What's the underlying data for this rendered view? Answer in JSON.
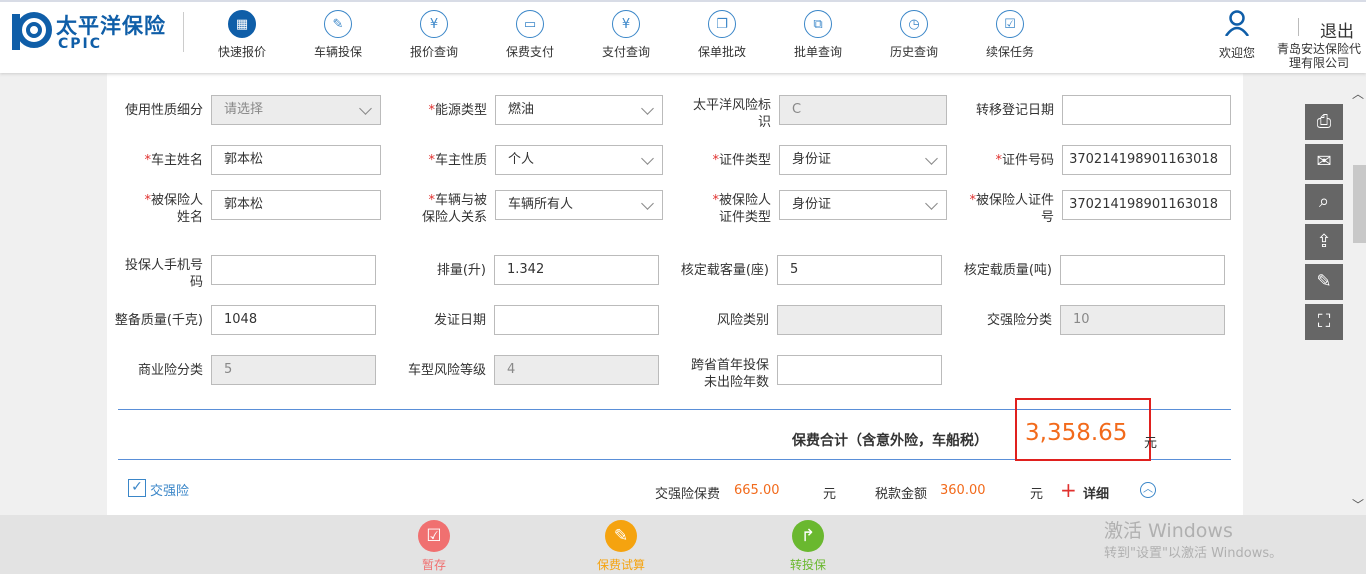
{
  "header": {
    "brand_cn": "太平洋保险",
    "brand_en": "CPIC",
    "nav": [
      {
        "label": "快速报价",
        "icon": "calculator-icon",
        "glyph": "▦"
      },
      {
        "label": "车辆投保",
        "icon": "policy-check-icon",
        "glyph": "✎"
      },
      {
        "label": "报价查询",
        "icon": "clipboard-yen-icon",
        "glyph": "¥"
      },
      {
        "label": "保费支付",
        "icon": "card-icon",
        "glyph": "▭"
      },
      {
        "label": "支付查询",
        "icon": "yen-search-icon",
        "glyph": "¥"
      },
      {
        "label": "保单批改",
        "icon": "copy-check-icon",
        "glyph": "❐"
      },
      {
        "label": "批单查询",
        "icon": "copy-search-icon",
        "glyph": "⧉"
      },
      {
        "label": "历史查询",
        "icon": "clock-icon",
        "glyph": "◷"
      },
      {
        "label": "续保任务",
        "icon": "task-check-icon",
        "glyph": "☑"
      }
    ],
    "welcome": "欢迎您",
    "company": "青岛安达保险代理有限公司",
    "logout": "退出"
  },
  "form": {
    "rows": [
      [
        {
          "label": "使用性质细分",
          "req": false,
          "value": "请选择",
          "type": "sel dis"
        },
        {
          "label": "能源类型",
          "req": true,
          "value": "燃油",
          "type": "sel"
        },
        {
          "label": "太平洋风险标\n识",
          "req": false,
          "value": "C",
          "type": "dis"
        },
        {
          "label": "转移登记日期",
          "req": false,
          "value": "",
          "type": ""
        }
      ],
      [
        {
          "label": "车主姓名",
          "req": true,
          "value": "郭本松",
          "type": ""
        },
        {
          "label": "车主性质",
          "req": true,
          "value": "个人",
          "type": "sel"
        },
        {
          "label": "证件类型",
          "req": true,
          "value": "身份证",
          "type": "sel"
        },
        {
          "label": "证件号码",
          "req": true,
          "value": "370214198901163018",
          "type": ""
        }
      ],
      [
        {
          "label": "被保险人\n姓名",
          "req": true,
          "value": "郭本松",
          "type": ""
        },
        {
          "label": "车辆与被\n保险人关系",
          "req": true,
          "value": "车辆所有人",
          "type": "sel"
        },
        {
          "label": "被保险人\n证件类型",
          "req": true,
          "value": "身份证",
          "type": "sel"
        },
        {
          "label": "被保险人证件\n号",
          "req": true,
          "value": "370214198901163018",
          "type": ""
        }
      ],
      [
        {
          "label": "投保人手机号\n码",
          "req": false,
          "value": "",
          "type": ""
        },
        {
          "label": "排量(升)",
          "req": false,
          "value": "1.342",
          "type": ""
        },
        {
          "label": "核定载客量(座)",
          "req": false,
          "value": "5",
          "type": ""
        },
        {
          "label": "核定载质量(吨)",
          "req": false,
          "value": "",
          "type": ""
        }
      ],
      [
        {
          "label": "整备质量(千克)",
          "req": false,
          "value": "1048",
          "type": ""
        },
        {
          "label": "发证日期",
          "req": false,
          "value": "",
          "type": ""
        },
        {
          "label": "风险类别",
          "req": false,
          "value": "",
          "type": "dis"
        },
        {
          "label": "交强险分类",
          "req": false,
          "value": "10",
          "type": "dis"
        }
      ],
      [
        {
          "label": "商业险分类",
          "req": false,
          "value": "5",
          "type": "dis"
        },
        {
          "label": "车型风险等级",
          "req": false,
          "value": "4",
          "type": "dis"
        },
        {
          "label": "跨省首年投保\n未出险年数",
          "req": false,
          "value": "",
          "type": ""
        }
      ]
    ]
  },
  "total": {
    "label": "保费合计（含意外险，车船税）",
    "value": "3,358.65",
    "unit": "元"
  },
  "compulsory": {
    "checkbox_label": "交强险",
    "checked": true,
    "premium_label": "交强险保费",
    "premium": "665.00",
    "unit": "元",
    "tax_label": "税款金额",
    "tax": "360.00",
    "detail": "详细"
  },
  "footer": [
    {
      "label": "暂存",
      "color": "#f07070",
      "glyph": "☑"
    },
    {
      "label": "保费试算",
      "color": "#f5a30f",
      "glyph": "✎"
    },
    {
      "label": "转投保",
      "color": "#6ab82f",
      "glyph": "↱"
    }
  ],
  "tools": [
    {
      "icon": "print-icon",
      "glyph": "⎙"
    },
    {
      "icon": "mail-icon",
      "glyph": "✉"
    },
    {
      "icon": "search-icon",
      "glyph": "⌕"
    },
    {
      "icon": "upload-icon",
      "glyph": "⇪"
    },
    {
      "icon": "edit-icon",
      "glyph": "✎"
    },
    {
      "icon": "scan-icon",
      "glyph": "⛶"
    }
  ],
  "watermark": {
    "line1": "激活 Windows",
    "line2": "转到\"设置\"以激活 Windows。"
  }
}
